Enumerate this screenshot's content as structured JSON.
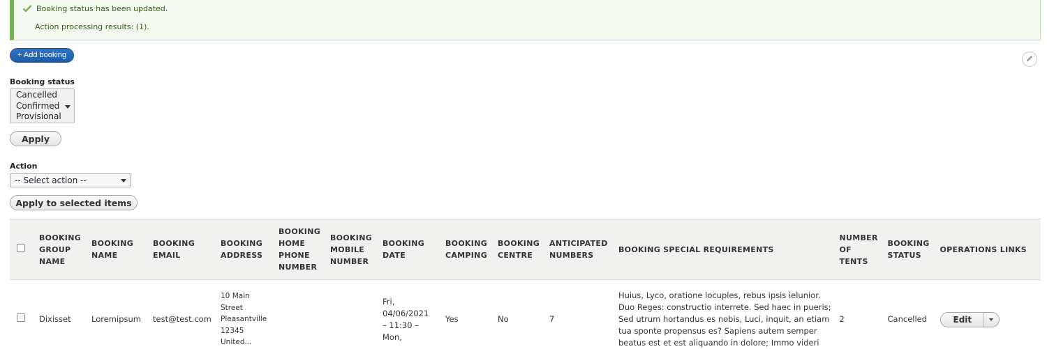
{
  "messages": {
    "status": "Booking status has been updated.",
    "result": "Action processing results: (1).",
    "icon": "check-icon",
    "accent_color": "#77b259"
  },
  "toolbar": {
    "add_booking_label": "+ Add booking",
    "edit_icon": "pencil-icon"
  },
  "filters": {
    "booking_status_label": "Booking status",
    "booking_status_options": [
      "Cancelled",
      "Confirmed",
      "Provisional"
    ],
    "apply_label": "Apply"
  },
  "bulk": {
    "action_label": "Action",
    "action_selected": "-- Select action --",
    "apply_selected_label": "Apply to selected items"
  },
  "table": {
    "columns": [
      "BOOKING GROUP NAME",
      "BOOKING NAME",
      "BOOKING EMAIL",
      "BOOKING ADDRESS",
      "BOOKING HOME PHONE NUMBER",
      "BOOKING MOBILE NUMBER",
      "BOOKING DATE",
      "BOOKING CAMPING",
      "BOOKING CENTRE",
      "ANTICIPATED NUMBERS",
      "BOOKING SPECIAL REQUIREMENTS",
      "NUMBER OF TENTS",
      "BOOKING STATUS",
      "OPERATIONS LINKS"
    ],
    "column_lines": [
      [
        "BOOKING",
        "GROUP",
        "NAME"
      ],
      [
        "BOOKING",
        "NAME"
      ],
      [
        "BOOKING",
        "EMAIL"
      ],
      [
        "BOOKING",
        "ADDRESS"
      ],
      [
        "BOOKING",
        "HOME",
        "PHONE",
        "NUMBER"
      ],
      [
        "BOOKING",
        "MOBILE",
        "NUMBER"
      ],
      [
        "BOOKING",
        "DATE"
      ],
      [
        "BOOKING",
        "CAMPING"
      ],
      [
        "BOOKING",
        "CENTRE"
      ],
      [
        "ANTICIPATED",
        "NUMBERS"
      ],
      [
        "BOOKING SPECIAL REQUIREMENTS"
      ],
      [
        "NUMBER",
        "OF",
        "TENTS"
      ],
      [
        "BOOKING",
        "STATUS"
      ],
      [
        "OPERATIONS LINKS"
      ]
    ],
    "rows": [
      {
        "group_name": "Dixisset",
        "name": "Loremipsum",
        "email": "test@test.com",
        "address_lines": [
          "10 Main",
          "Street",
          "Pleasantville",
          "12345",
          "United..."
        ],
        "home_phone": "",
        "mobile": "",
        "date_lines": [
          "Fri,",
          "04/06/2021",
          "– 11:30 –",
          "Mon,"
        ],
        "camping": "Yes",
        "centre": "No",
        "anticipated": "7",
        "special_lines": [
          "Huius, Lyco, oratione locuples, rebus ipsis ielunior.",
          "Duo Reges: constructio interrete. Sed haec in pueris;",
          "Sed utrum hortandus es nobis, Luci, inquit, an etiam",
          "tua sponte propensus es? Sapiens autem semper",
          "beatus est et est aliquando in dolore; Immo videri"
        ],
        "tents": "2",
        "status": "Cancelled",
        "edit_label": "Edit"
      }
    ]
  }
}
